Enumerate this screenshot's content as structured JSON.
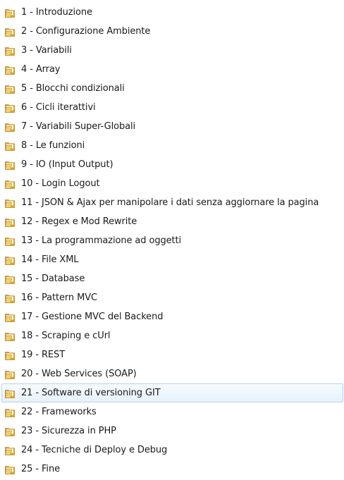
{
  "folders": [
    {
      "label": "1 - Introduzione",
      "icon": "folder-icon",
      "selected": false
    },
    {
      "label": "2 - Configurazione Ambiente",
      "icon": "folder-icon",
      "selected": false
    },
    {
      "label": "3 - Variabili",
      "icon": "folder-icon",
      "selected": false
    },
    {
      "label": "4 - Array",
      "icon": "folder-icon",
      "selected": false
    },
    {
      "label": "5 - Blocchi condizionali",
      "icon": "folder-icon",
      "selected": false
    },
    {
      "label": "6 - Cicli iterattivi",
      "icon": "folder-icon",
      "selected": false
    },
    {
      "label": "7 - Variabili Super-Globali",
      "icon": "folder-icon",
      "selected": false
    },
    {
      "label": "8 - Le funzioni",
      "icon": "folder-icon",
      "selected": false
    },
    {
      "label": "9 - IO (Input Output)",
      "icon": "folder-icon",
      "selected": false
    },
    {
      "label": "10 - Login Logout",
      "icon": "folder-icon",
      "selected": false
    },
    {
      "label": "11 - JSON & Ajax per manipolare i dati senza aggiornare la pagina",
      "icon": "folder-icon",
      "selected": false
    },
    {
      "label": "12 - Regex e Mod Rewrite",
      "icon": "folder-icon",
      "selected": false
    },
    {
      "label": "13 - La programmazione ad oggetti",
      "icon": "folder-icon",
      "selected": false
    },
    {
      "label": "14 - File XML",
      "icon": "folder-icon",
      "selected": false
    },
    {
      "label": "15 - Database",
      "icon": "folder-icon",
      "selected": false
    },
    {
      "label": "16 - Pattern MVC",
      "icon": "folder-icon",
      "selected": false
    },
    {
      "label": "17 - Gestione MVC del Backend",
      "icon": "folder-icon",
      "selected": false
    },
    {
      "label": "18 - Scraping e cUrl",
      "icon": "folder-icon",
      "selected": false
    },
    {
      "label": "19 - REST",
      "icon": "folder-icon",
      "selected": false
    },
    {
      "label": "20 - Web Services (SOAP)",
      "icon": "folder-icon",
      "selected": false
    },
    {
      "label": "21 - Software di versioning GIT",
      "icon": "folder-icon",
      "selected": true
    },
    {
      "label": "22 - Frameworks",
      "icon": "folder-icon",
      "selected": false
    },
    {
      "label": "23 - Sicurezza in PHP",
      "icon": "folder-icon",
      "selected": false
    },
    {
      "label": "24 - Tecniche di Deploy e Debug",
      "icon": "folder-icon",
      "selected": false
    },
    {
      "label": "25 - Fine",
      "icon": "folder-icon",
      "selected": false
    }
  ],
  "colors": {
    "folder_front": "#f3cf6a",
    "folder_back": "#d9a634",
    "folder_edge": "#b9892a",
    "selection_border": "#b9d3ee",
    "text": "#1a1a1a"
  }
}
